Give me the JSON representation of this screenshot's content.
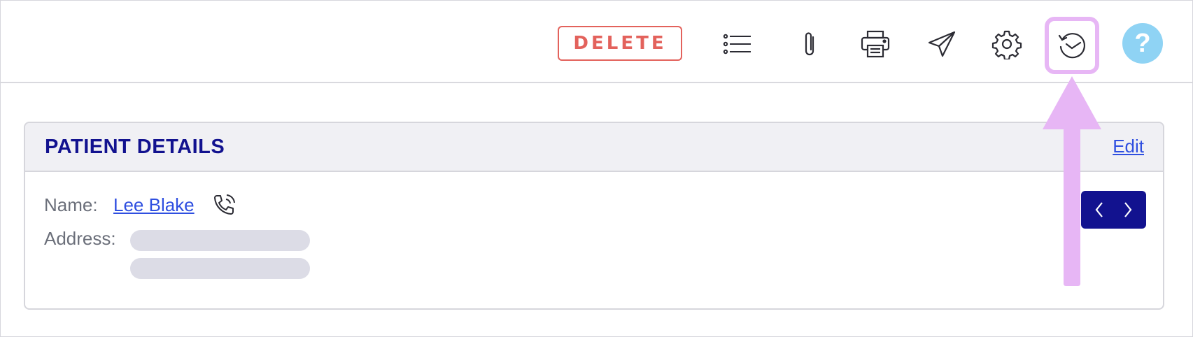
{
  "toolbar": {
    "delete_label": "DELETE",
    "help_label": "?",
    "icons": [
      "list-icon",
      "paperclip-icon",
      "printer-icon",
      "send-icon",
      "gear-icon",
      "history-icon"
    ]
  },
  "colors": {
    "delete": "#e3625c",
    "accent_navy": "#12128f",
    "link": "#2f4fe0",
    "highlight": "#e7b6f5",
    "help": "#8fd3f4"
  },
  "card": {
    "title": "PATIENT DETAILS",
    "edit_label": "Edit",
    "name_label": "Name:",
    "name_value": "Lee Blake ",
    "address_label": "Address:"
  }
}
